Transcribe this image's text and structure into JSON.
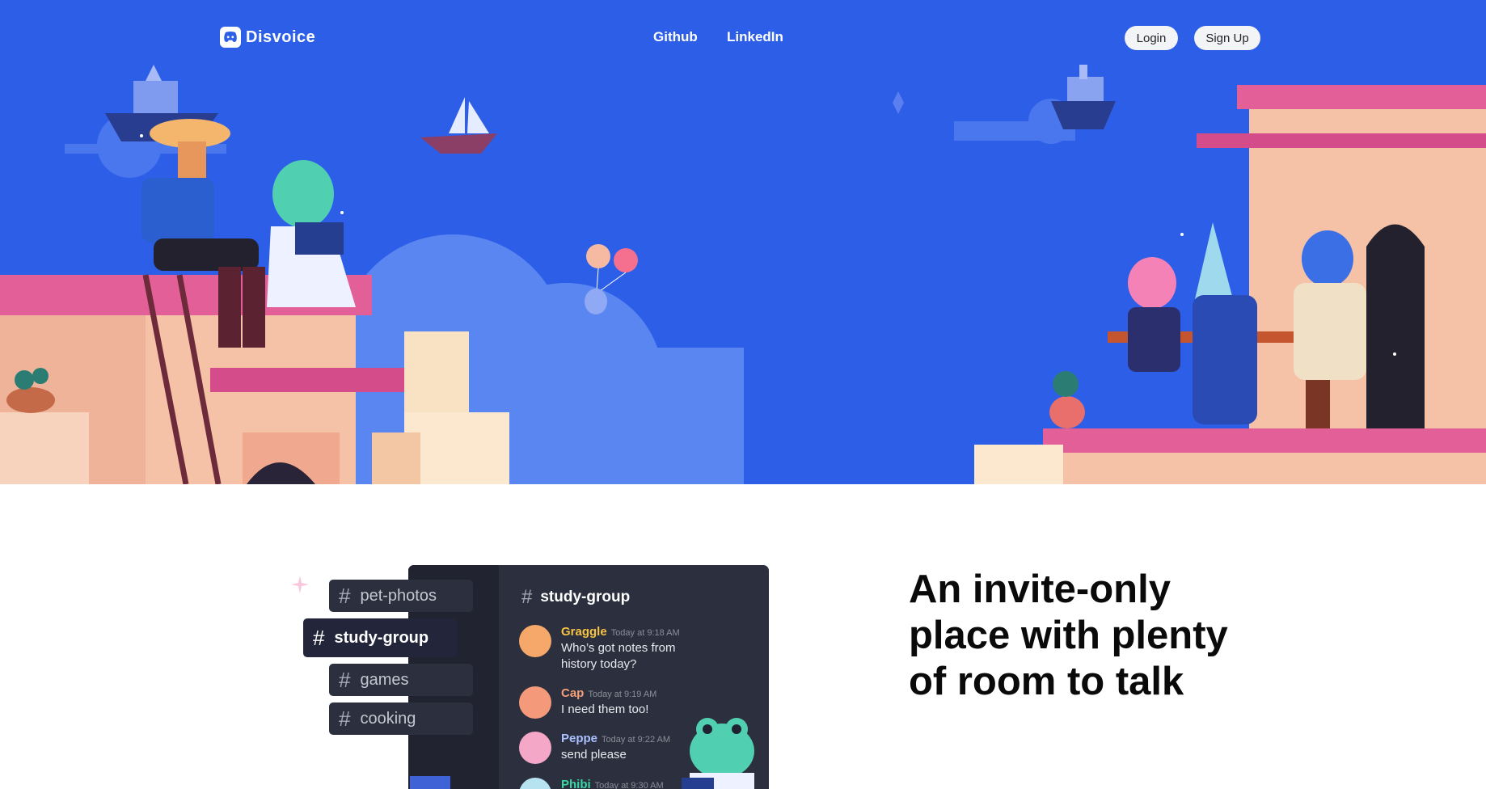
{
  "nav": {
    "brand": "Disvoice",
    "links": [
      "Github",
      "LinkedIn"
    ],
    "login": "Login",
    "signup": "Sign Up"
  },
  "mockup": {
    "channels": [
      "pet-photos",
      "study-group",
      "games",
      "cooking"
    ],
    "active_channel": "study-group",
    "header_channel": "study-group",
    "messages": [
      {
        "name": "Graggle",
        "time": "Today at 9:18 AM",
        "text": "Who’s got notes from history today?",
        "name_color": "#f6c343"
      },
      {
        "name": "Cap",
        "time": "Today at 9:19 AM",
        "text": "I need them too!",
        "name_color": "#f4a07a"
      },
      {
        "name": "Peppe",
        "time": "Today at 9:22 AM",
        "text": "send please",
        "name_color": "#a9c1ff"
      },
      {
        "name": "Phibi",
        "time": "Today at 9:30 AM",
        "text": "",
        "name_color": "#3ad7a5"
      }
    ]
  },
  "section": {
    "headline": "An invite-only place with plenty of room to talk"
  },
  "colors": {
    "hero_bg": "#2c5ee8",
    "mock_bg": "#2c2f3d",
    "mock_sidebar": "#212330"
  }
}
